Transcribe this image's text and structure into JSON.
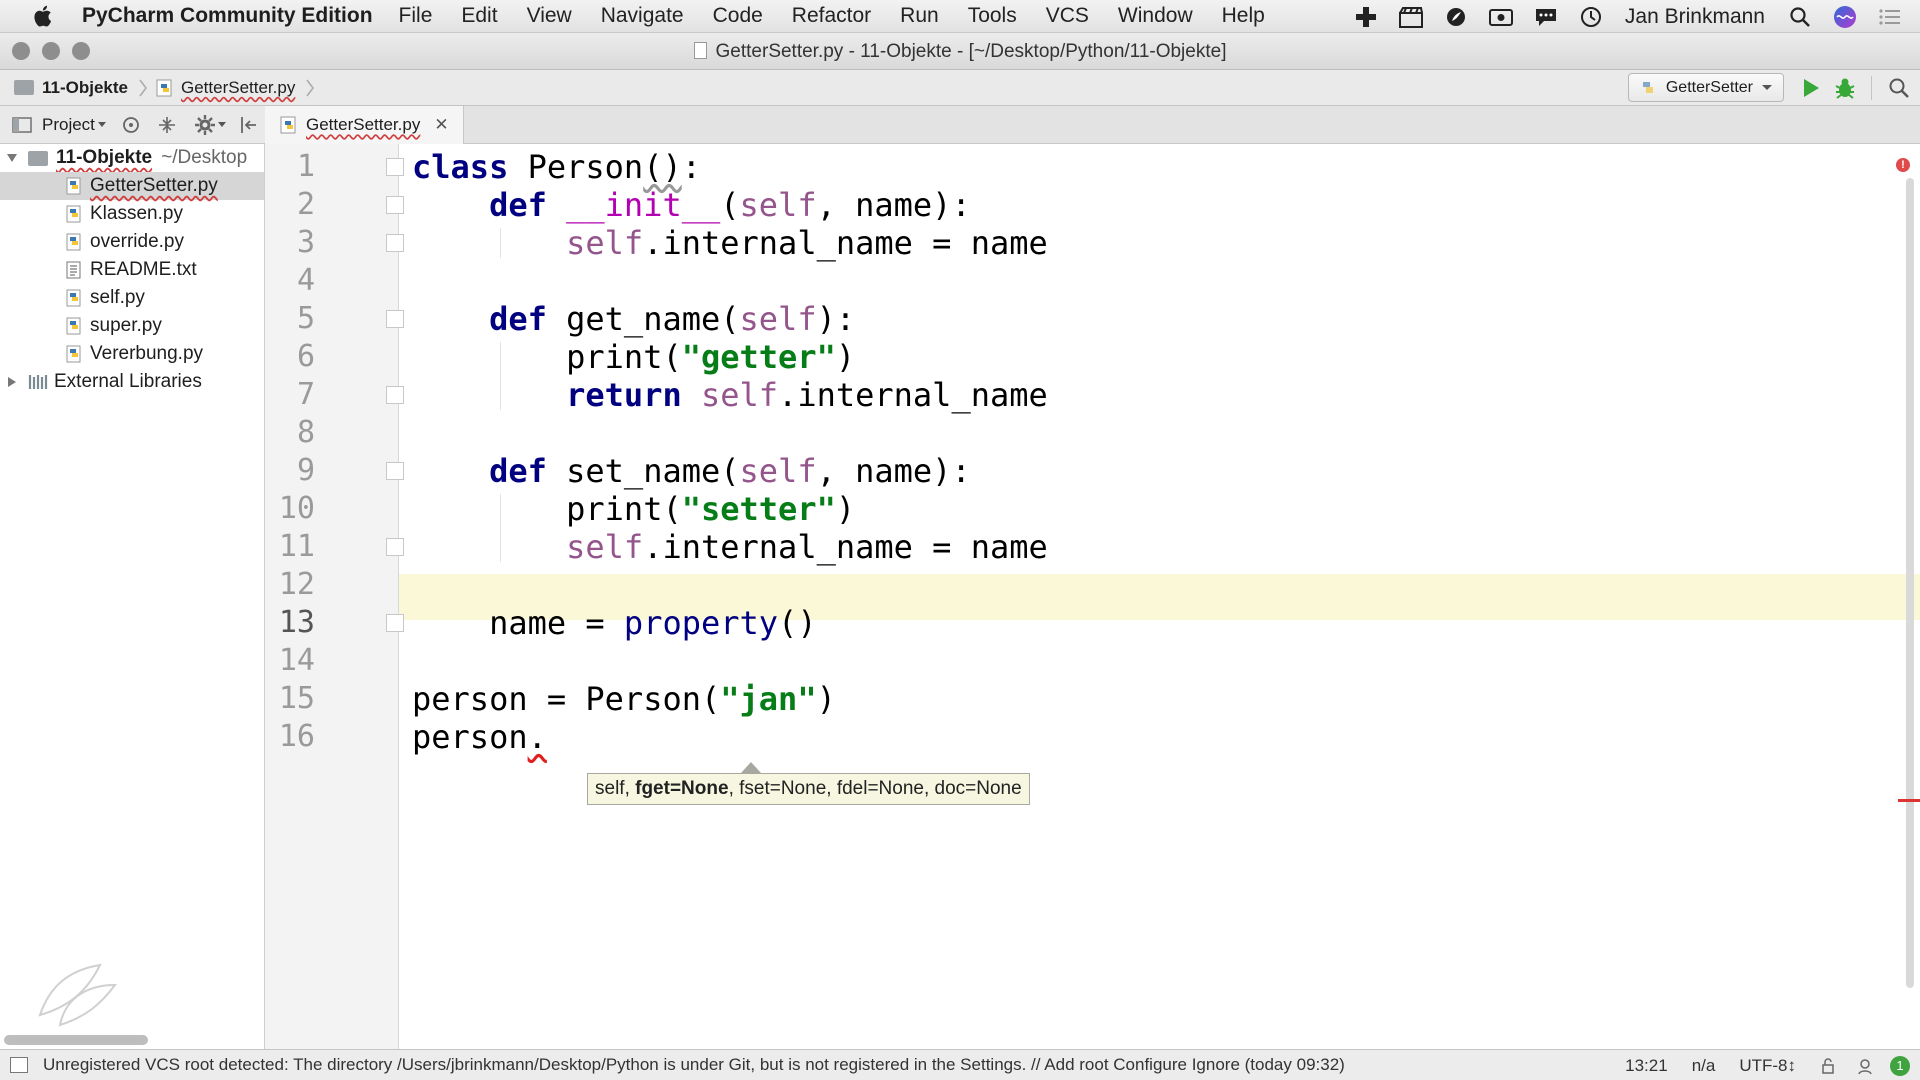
{
  "menubar": {
    "app_name": "PyCharm Community Edition",
    "items": [
      "File",
      "Edit",
      "View",
      "Navigate",
      "Code",
      "Refactor",
      "Run",
      "Tools",
      "VCS",
      "Window",
      "Help"
    ],
    "user_name": "Jan Brinkmann"
  },
  "window": {
    "title": "GetterSetter.py - 11-Objekte - [~/Desktop/Python/11-Objekte]"
  },
  "navbar": {
    "breadcrumbs": [
      "11-Objekte",
      "GetterSetter.py"
    ],
    "run_config": "GetterSetter"
  },
  "project_panel": {
    "label": "Project"
  },
  "tabs": [
    {
      "label": "GetterSetter.py",
      "active": true
    }
  ],
  "tree": {
    "root_label": "11-Objekte",
    "root_path": "~/Desktop",
    "files": [
      "GetterSetter.py",
      "Klassen.py",
      "override.py",
      "README.txt",
      "self.py",
      "super.py",
      "Vererbung.py"
    ],
    "selected": "GetterSetter.py",
    "external": "External Libraries"
  },
  "editor": {
    "line_numbers": [
      "1",
      "2",
      "3",
      "4",
      "5",
      "6",
      "7",
      "8",
      "9",
      "10",
      "11",
      "12",
      "13",
      "14",
      "15",
      "16"
    ],
    "current_line": 13,
    "code_lines": [
      "class Person():",
      "    def __init__(self, name):",
      "        self.internal_name = name",
      "",
      "    def get_name(self):",
      "        print(\"getter\")",
      "        return self.internal_name",
      "",
      "    def set_name(self, name):",
      "        print(\"setter\")",
      "        self.internal_name = name",
      "",
      "    name = property()",
      "",
      "person = Person(\"jan\")",
      "person."
    ],
    "param_hint": {
      "prefix": "self, ",
      "current": "fget=None",
      "rest": ", fset=None, fdel=None, doc=None"
    },
    "error_count_badge": "!"
  },
  "statusbar": {
    "message": "Unregistered VCS root detected: The directory /Users/jbrinkmann/Desktop/Python is under Git, but is not registered in the Settings. // Add root  Configure  Ignore (today 09:32)",
    "position": "13:21",
    "line_sep": "n/a",
    "encoding": "UTF-8↕",
    "events_count": "1"
  },
  "colors": {
    "keyword": "#000080",
    "self": "#94558d",
    "string": "#067d17",
    "current_line_bg": "#fbf8d8",
    "error": "#e02020"
  }
}
